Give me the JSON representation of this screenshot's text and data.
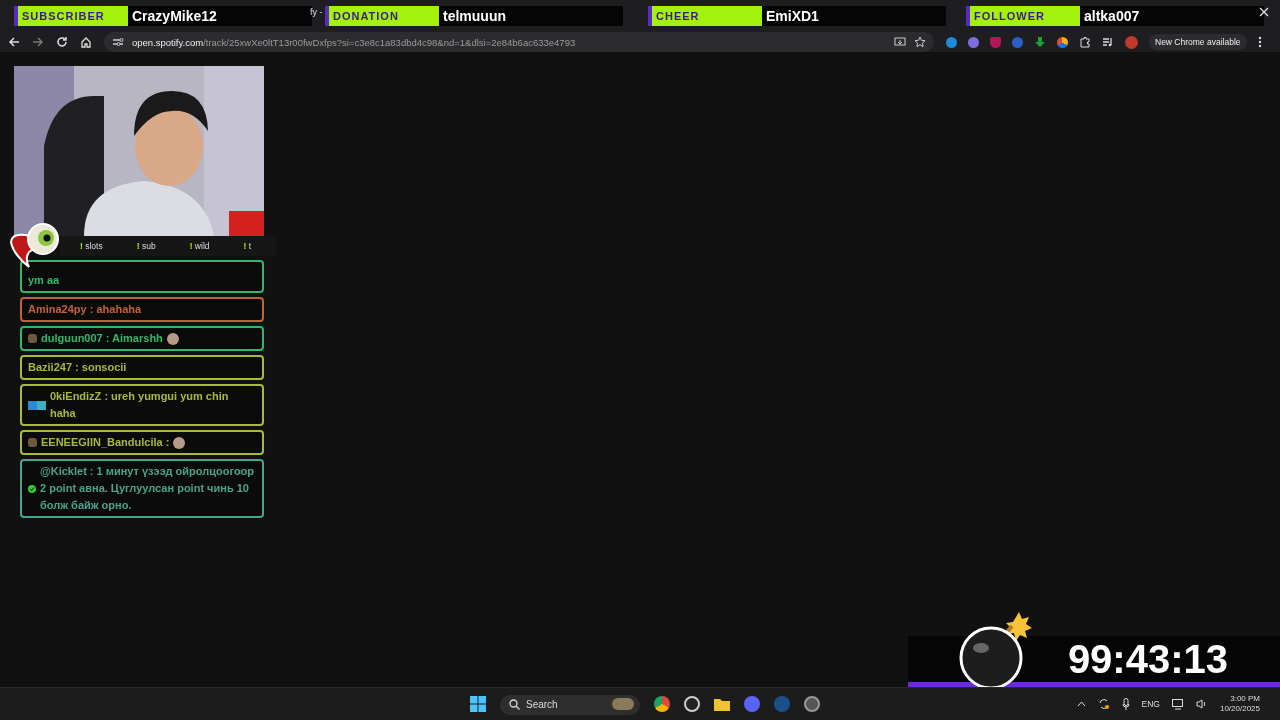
{
  "alerts": [
    {
      "label": "SUBSCRIBER",
      "name": "CrazyMike12"
    },
    {
      "label": "DONATION",
      "name": "telmuuun"
    },
    {
      "label": "CHEER",
      "name": "EmiXD1"
    },
    {
      "label": "FOLLOWER",
      "name": "altka007"
    }
  ],
  "tab_fragment": "fy -",
  "browser": {
    "url_host": "open.spotify.com",
    "url_path": "/track/25xwXe0ltT13r00fwDxfps?si=c3e8c1a83dbd4c98&nd=1&dlsi=2e84b6ac633e4793",
    "update_button": "New Chrome available"
  },
  "commands": [
    {
      "mark": "!",
      "label": "slots"
    },
    {
      "mark": "!",
      "label": "sub"
    },
    {
      "mark": "!",
      "label": "wild"
    },
    {
      "mark": "!",
      "label": "t"
    }
  ],
  "chat": [
    {
      "kind": "plain",
      "text": "ym aa",
      "color": "#2fb86a",
      "emote": false
    },
    {
      "kind": "plain",
      "text": "Amina24py : ahahaha",
      "color": "#c2623a",
      "emote": false
    },
    {
      "kind": "badged",
      "text": "dulguun007 : Aimarshh",
      "color": "#2fb86a",
      "emote": true
    },
    {
      "kind": "plain",
      "text": "Bazii247 : sonsocii",
      "color": "#a9b93a",
      "emote": false
    },
    {
      "kind": "tools",
      "text": "0kiEndizZ : ureh yumgui yum chin haha",
      "color": "#a9b93a",
      "emote": false
    },
    {
      "kind": "badged",
      "text": "EENEEGIIN_Bandulcila :",
      "color": "#a9b93a",
      "emote": true
    },
    {
      "kind": "verified",
      "text": "@Kicklet : 1 минут үзээд ойролцоогоор 2 point авна. Цуглуулсан point чинь 10 болж байж орно.",
      "color": "#4aa38a",
      "emote": false
    }
  ],
  "timer": "99:43:13",
  "taskbar": {
    "search_placeholder": "Search",
    "language": "ENG",
    "time": "3:00 PM",
    "date": "10/20/2025"
  }
}
